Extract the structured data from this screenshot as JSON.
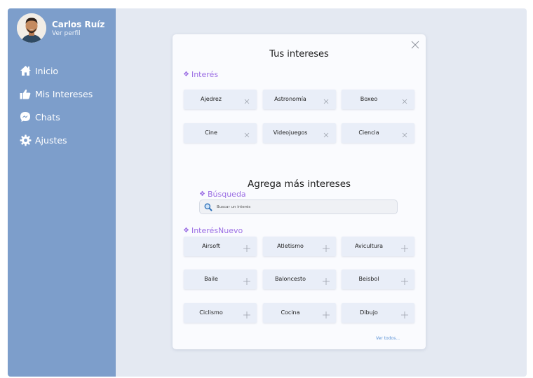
{
  "user": {
    "name": "Carlos Ruíz",
    "profile_link": "Ver perfil"
  },
  "nav": [
    {
      "label": "Inicio",
      "icon": "home-icon"
    },
    {
      "label": "Mis Intereses",
      "icon": "thumbs-up-icon"
    },
    {
      "label": "Chats",
      "icon": "messenger-icon"
    },
    {
      "label": "Ajustes",
      "icon": "gear-icon"
    }
  ],
  "modal": {
    "title": "Tus intereses",
    "current_section_label": "Interés",
    "current": [
      "Ajedrez",
      "Astronomía",
      "Boxeo",
      "Cine",
      "Videojuegos",
      "Ciencia"
    ],
    "add_title": "Agrega más intereses",
    "search_section_label": "Búsqueda",
    "search_placeholder": "Buscar un interés",
    "new_section_label": "InterésNuevo",
    "suggestions": [
      "Airsoft",
      "Atletismo",
      "Avicultura",
      "Baile",
      "Baloncesto",
      "Beisbol",
      "Ciclismo",
      "Cocina",
      "Dibujo"
    ],
    "see_all": "Ver todos..."
  },
  "colors": {
    "sidebar": "#7d9ecb",
    "accent_purple": "#9c6fe4",
    "background": "#e4e9f2",
    "chip": "#e9eef8",
    "link": "#5b93d6"
  }
}
